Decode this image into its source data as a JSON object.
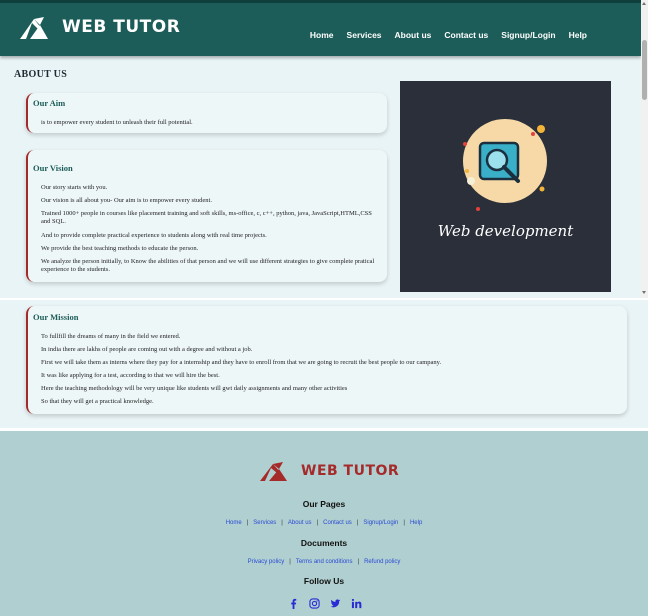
{
  "brand": {
    "name": "WEB TUTOR",
    "primary": "#1c5d59",
    "accent": "#a52a2a"
  },
  "nav": {
    "items": [
      "Home",
      "Services",
      "About us",
      "Contact us",
      "Signup/Login",
      "Help"
    ]
  },
  "about": {
    "heading": "ABOUT US",
    "aim": {
      "title": "Our Aim",
      "text": "is to empower every student to unleash their full potential."
    },
    "vision": {
      "title": "Our Vision",
      "paragraphs": [
        "Our story starts with you.",
        "Our vision is all about you- Our aim is to empower every student.",
        "Trained 1000+ people in courses like placement training and soft skills, ms-office, c, c++, python, java, JavaScript,HTML,CSS and SQL.",
        "And to provide complete practical experience to students along with real time projects.",
        "We provide the best teaching methods to educate the person.",
        "We analyze the person initially, to Know the abilities of that person and we will use different strategies to give complete pratical experience to the students."
      ]
    },
    "image_caption": "Web development",
    "mission": {
      "title": "Our Mission",
      "paragraphs": [
        "To fullfill the dreams of many in the field we entered.",
        "In india there are lakhs of people are coming out with a degree and without a job.",
        "First we will take them as interns where they pay for a internship and they have to enroll from that we are going to recruit the best people to our campany.",
        "It was like applying for a test, according to that we will hire the best.",
        "Here the teaching methodology will be very unique like students will gwt daily assignments and many other activities",
        "So that they will get a practical knowledge."
      ]
    }
  },
  "footer": {
    "pages_heading": "Our Pages",
    "pages": [
      "Home",
      "Services",
      "About us",
      "Contact us",
      "Signup/Login",
      "Help"
    ],
    "documents_heading": "Documents",
    "documents": [
      "Privacy policy",
      "Terms and conditions",
      "Refund policy"
    ],
    "follow_heading": "Follow Us",
    "social": [
      "facebook-icon",
      "instagram-icon",
      "twitter-icon",
      "linkedin-icon"
    ],
    "social_color": "#2a2ad4"
  }
}
